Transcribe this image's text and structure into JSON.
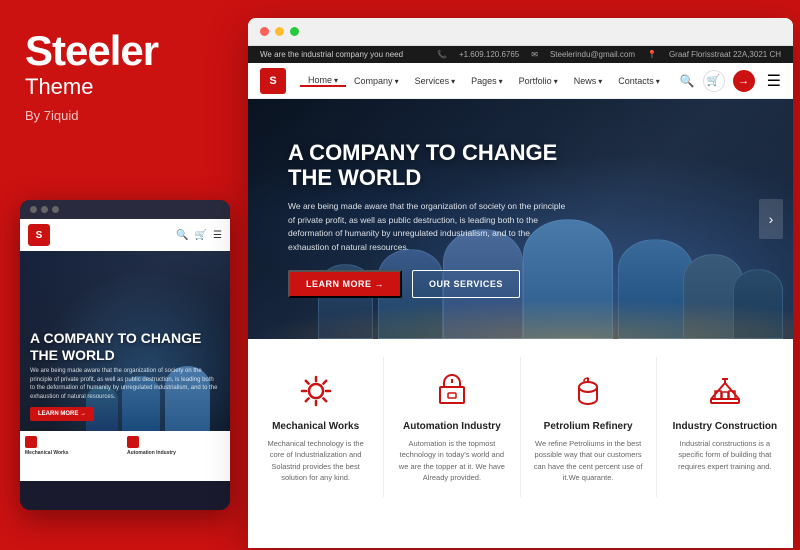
{
  "brand": {
    "title": "Steeler",
    "subtitle": "Theme",
    "by": "By 7iquid"
  },
  "browser": {
    "dots": [
      "red",
      "yellow",
      "green"
    ]
  },
  "topbar": {
    "tagline": "We are the industrial company you need",
    "phone": "+1.609.120.6765",
    "email": "Steelerindu@gmail.com",
    "address": "Graaf Florisstraat 22A,3021 CH"
  },
  "nav": {
    "logo_text": "S",
    "items": [
      {
        "label": "Home",
        "has_dropdown": true,
        "active": true
      },
      {
        "label": "Company",
        "has_dropdown": true
      },
      {
        "label": "Services",
        "has_dropdown": true
      },
      {
        "label": "Pages",
        "has_dropdown": true
      },
      {
        "label": "Portfolio",
        "has_dropdown": true
      },
      {
        "label": "News",
        "has_dropdown": true
      },
      {
        "label": "Contacts",
        "has_dropdown": true
      }
    ]
  },
  "hero": {
    "title": "A COMPANY TO CHANGE THE WORLD",
    "description": "We are being made aware that the organization of society on the principle of private profit, as well as public destruction, is leading both to the deformation of humanity by unregulated industrialism, and to the exhaustion of natural resources.",
    "btn_primary": "LEARN MORE →",
    "btn_outline": "OUR SERVICES"
  },
  "mobile_hero": {
    "title": "A COMPANY TO CHANGE THE WORLD",
    "description": "We are being made aware that the organization of society on the principle of private profit, as well as public destruction, is leading both to the deformation of humanity by unregulated industrialism, and to the exhaustion of natural resources.",
    "btn": "LEARN MORE →"
  },
  "services": [
    {
      "icon": "⚙",
      "title": "Mechanical Works",
      "description": "Mechanical technology is the core of Industrialization and Solastrid provides the best solution for any kind."
    },
    {
      "icon": "🏭",
      "title": "Automation Industry",
      "description": "Automation is the topmost technology in today's world and we are the topper at it. We have Already provided."
    },
    {
      "icon": "🛢",
      "title": "Petrolium Refinery",
      "description": "We refine Petroliums in the best possible way that our customers can have the cent percent use of it.We quarante."
    },
    {
      "icon": "🏗",
      "title": "Industry Construction",
      "description": "Industrial constructions is a specific form of building that requires expert training and."
    }
  ]
}
